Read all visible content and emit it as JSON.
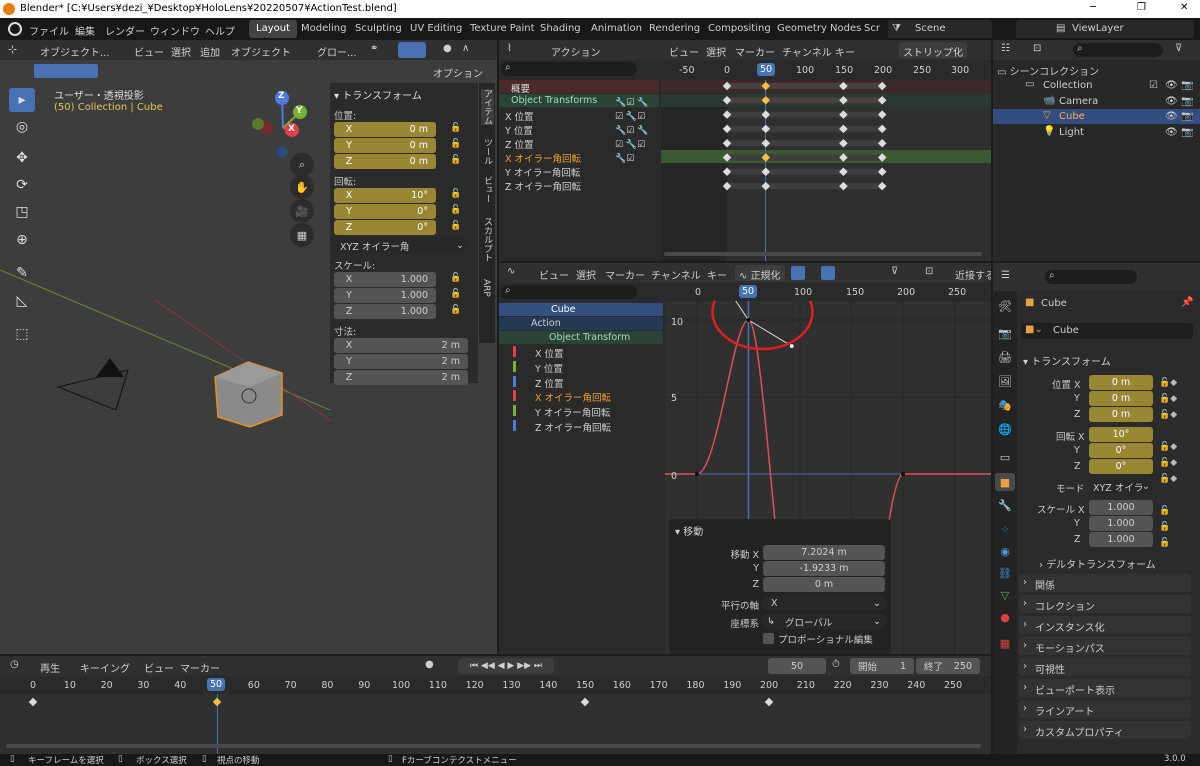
{
  "window": {
    "title": "Blender* [C:¥Users¥dezi_¥Desktop¥HoloLens¥20220507¥ActionTest.blend]",
    "min": "─",
    "max": "❐",
    "close": "✕"
  },
  "menu": [
    "ファイル",
    "編集",
    "レンダー",
    "ウィンドウ",
    "ヘルプ"
  ],
  "workspaces": [
    "Layout",
    "Modeling",
    "Sculpting",
    "UV Editing",
    "Texture Paint",
    "Shading",
    "Animation",
    "Rendering",
    "Compositing",
    "Geometry Nodes",
    "Scr"
  ],
  "scene": "Scene",
  "view_layer": "ViewLayer",
  "viewport": {
    "mode": "オブジェクト...",
    "menus": [
      "ビュー",
      "選択",
      "追加",
      "オブジェクト"
    ],
    "orient": "グロー...",
    "options": "オプション",
    "info1": "ユーザー・透視投影",
    "info2": "(50) Collection | Cube",
    "tabs": [
      "アイテム",
      "ツール",
      "ビュー",
      "スカルプト",
      "ARP"
    ],
    "npanel": {
      "title": "トランスフォーム",
      "loc_label": "位置:",
      "rot_label": "回転:",
      "scale_label": "スケール:",
      "dim_label": "寸法:",
      "loc": [
        {
          "k": "X",
          "v": "0 m"
        },
        {
          "k": "Y",
          "v": "0 m"
        },
        {
          "k": "Z",
          "v": "0 m"
        }
      ],
      "rot": [
        {
          "k": "X",
          "v": "10°"
        },
        {
          "k": "Y",
          "v": "0°"
        },
        {
          "k": "Z",
          "v": "0°"
        }
      ],
      "rot_mode": "XYZ オイラー角",
      "scale": [
        {
          "k": "X",
          "v": "1.000"
        },
        {
          "k": "Y",
          "v": "1.000"
        },
        {
          "k": "Z",
          "v": "1.000"
        }
      ],
      "dim": [
        {
          "k": "X",
          "v": "2 m"
        },
        {
          "k": "Y",
          "v": "2 m"
        },
        {
          "k": "Z",
          "v": "2 m"
        }
      ]
    },
    "gizmo": {
      "x": "X",
      "y": "Y",
      "z": "Z"
    }
  },
  "dopesheet": {
    "mode": "アクション",
    "menus": [
      "ビュー",
      "選択",
      "マーカー",
      "チャンネル",
      "キー"
    ],
    "strip": "ストリップ化",
    "ruler": [
      "-50",
      "0",
      "50",
      "100",
      "150",
      "200",
      "250",
      "300"
    ],
    "channels": [
      "概要",
      "Object Transforms",
      "X 位置",
      "Y 位置",
      "Z 位置",
      "X オイラー角回転",
      "Y オイラー角回転",
      "Z オイラー角回転"
    ]
  },
  "graph": {
    "menus": [
      "ビュー",
      "選択",
      "マーカー",
      "チャンネル",
      "キー"
    ],
    "normalize": "正規化",
    "snap": "近接する",
    "ruler": [
      "0",
      "50",
      "100",
      "150",
      "200",
      "250"
    ],
    "yticks": [
      "10",
      "5",
      "0"
    ],
    "channels": [
      "Cube",
      "Action",
      "Object Transform",
      "X 位置",
      "Y 位置",
      "Z 位置",
      "X オイラー角回転",
      "Y オイラー角回転",
      "Z オイラー角回転"
    ],
    "op": {
      "title": "移動",
      "mx_label": "移動 X",
      "mx": "7.2024 m",
      "my_label": "Y",
      "my": "-1.9233 m",
      "mz_label": "Z",
      "mz": "0 m",
      "axis_label": "平行の軸",
      "axis": "X",
      "space_label": "座標系",
      "space": "グローバル",
      "prop": "プロポーショナル編集"
    }
  },
  "outliner": {
    "scene_coll": "シーンコレクション",
    "items": [
      "Collection",
      "Camera",
      "Cube",
      "Light"
    ]
  },
  "props": {
    "object": "Cube",
    "data": "Cube",
    "section": "トランスフォーム",
    "loc_label": "位置 X",
    "rot_label": "回転 X",
    "mode_label": "モード",
    "mode": "XYZ オイラ",
    "scale_label": "スケール X",
    "loc": [
      "0 m",
      "0 m",
      "0 m"
    ],
    "rot": [
      "10°",
      "0°",
      "0°"
    ],
    "scale": [
      "1.000",
      "1.000",
      "1.000"
    ],
    "subsections": [
      "デルタトランスフォーム",
      "関係",
      "コレクション",
      "インスタンス化",
      "モーションパス",
      "可視性",
      "ビューポート表示",
      "ラインアート",
      "カスタムプロパティ"
    ]
  },
  "timeline": {
    "menus": [
      "再生",
      "キーイング",
      "ビュー",
      "マーカー"
    ],
    "current": "50",
    "start_label": "開始",
    "start": "1",
    "end_label": "終了",
    "end": "250",
    "ruler": [
      "0",
      "10",
      "20",
      "30",
      "40",
      "50",
      "60",
      "70",
      "80",
      "90",
      "100",
      "110",
      "120",
      "130",
      "140",
      "150",
      "160",
      "170",
      "180",
      "190",
      "200",
      "210",
      "220",
      "230",
      "240",
      "250"
    ]
  },
  "status": {
    "s1": "キーフレームを選択",
    "s2": "ボックス選択",
    "s3": "視点の移動",
    "s4": "Fカーブコンテクストメニュー",
    "version": "3.0.0"
  },
  "chart_data": {
    "type": "line",
    "title": "",
    "xlabel": "",
    "ylabel": "",
    "x": [
      0,
      50,
      100,
      150,
      200,
      250
    ],
    "series": [
      {
        "name": "X オイラー角回転",
        "values": [
          0,
          10,
          0,
          0,
          0,
          0
        ]
      }
    ],
    "xlim": [
      -30,
      280
    ],
    "ylim": [
      -6,
      12
    ]
  }
}
